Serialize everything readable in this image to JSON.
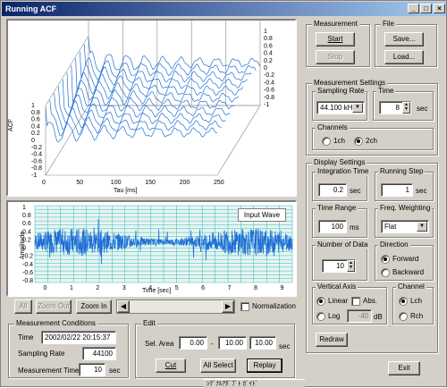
{
  "window": {
    "title": "Running ACF"
  },
  "acf_plot": {
    "ylabel": "ACF",
    "xlabel": "Tau [ms]",
    "yticks": [
      "1",
      "0.8",
      "0.6",
      "0.4",
      "0.2",
      "0",
      "-0.2",
      "-0.4",
      "-0.6",
      "-0.8",
      "-1"
    ],
    "zticks": [
      "1",
      "0.8",
      "0.6",
      "0.4",
      "0.2",
      "0",
      "-0.2",
      "-0.4",
      "-0.6",
      "-0.8",
      "-1"
    ],
    "xticks": [
      "0",
      "50",
      "100",
      "150",
      "200",
      "250"
    ]
  },
  "wave_plot": {
    "ylabel": "Amplitude",
    "xlabel": "Time [sec]",
    "yticks": [
      "1",
      "0.8",
      "0.6",
      "0.4",
      "0.2",
      "0",
      "-0.2",
      "-0.4",
      "-0.6",
      "-0.8"
    ],
    "xticks": [
      "0",
      "1",
      "2",
      "3",
      "4",
      "5",
      "6",
      "7",
      "8",
      "9"
    ],
    "legend": "Input Wave",
    "wave_color": "#1f6fd6",
    "grid_color": "#00b0a8"
  },
  "toolbar": {
    "all": "All",
    "zoom_out": "Zoom Out",
    "zoom_in": "Zoom In",
    "normalization": "Normalization"
  },
  "measurement": {
    "title": "Measurement",
    "start": "Start",
    "stop": "Stop"
  },
  "file": {
    "title": "File",
    "save": "Save...",
    "load": "Load..."
  },
  "measurement_settings": {
    "title": "Measurement Settings",
    "sampling_rate_title": "Sampling Rate",
    "sampling_rate": "44.100 kHz",
    "time_title": "Time",
    "time": "8",
    "time_unit": "sec",
    "channels_title": "Channels",
    "ch1": "1ch",
    "ch2": "2ch"
  },
  "display_settings": {
    "title": "Display Settings",
    "integration_time_title": "Integration Time",
    "integration_time": "0.2",
    "integration_unit": "sec",
    "running_step_title": "Running Step",
    "running_step": "1",
    "running_step_unit": "sec",
    "time_range_title": "Time Range",
    "time_range": "100",
    "time_range_unit": "ms",
    "freq_weighting_title": "Freq. Weighting",
    "freq_weighting": "Flat",
    "number_of_data_title": "Number of Data",
    "number_of_data": "10",
    "direction_title": "Direction",
    "forward": "Forward",
    "backward": "Backward",
    "vertical_axis_title": "Vertical Axis",
    "linear": "Linear",
    "abs": "Abs.",
    "log": "Log",
    "log_value": "-40",
    "log_unit": "dB",
    "channel_title": "Channel",
    "lch": "Lch",
    "rch": "Rch",
    "redraw": "Redraw"
  },
  "conditions": {
    "title": "Measurement Conditions",
    "time_label": "Time",
    "time_value": "2002/02/22 20:15:37",
    "sampling_label": "Sampling Rate",
    "sampling_value": "44100",
    "mtime_label": "Measurement Time",
    "mtime_value": "10",
    "mtime_unit": "sec"
  },
  "edit": {
    "title": "Edit",
    "sel_area_label": "Sel. Area",
    "start": "0.00",
    "dash": "-",
    "end": "10.00",
    "length": "10.00",
    "unit": "sec",
    "cut": "Cut",
    "all_select": "All Select",
    "replay": "Replay"
  },
  "exit": "Exit",
  "taskbar": {
    "label": "ｼｸﾞﾅﾙｱﾀﾞﾌﾟﾄ ｶﾞｲﾄﾞ"
  }
}
